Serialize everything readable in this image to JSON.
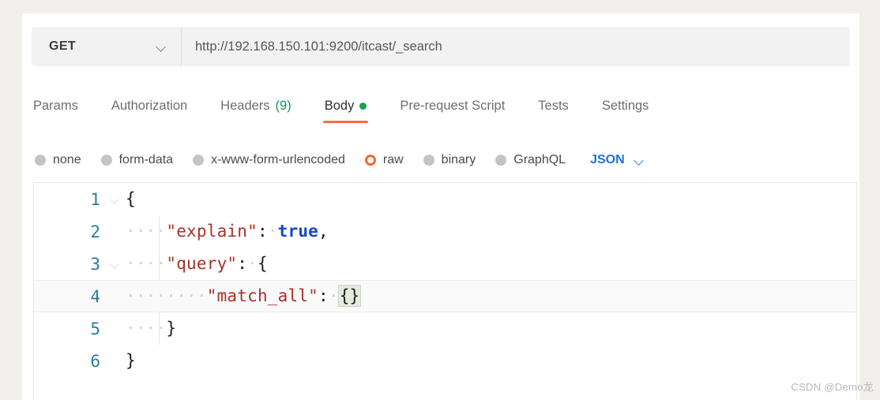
{
  "request_bar": {
    "method": "GET",
    "method_dropdown_icon": "chevron-down-icon",
    "url": "http://192.168.150.101:9200/itcast/_search",
    "url_placeholder": "Enter request URL"
  },
  "tabs": [
    {
      "label": "Params",
      "active": false,
      "count": null,
      "dot": false
    },
    {
      "label": "Authorization",
      "active": false,
      "count": null,
      "dot": false
    },
    {
      "label": "Headers",
      "active": false,
      "count": "(9)",
      "dot": false
    },
    {
      "label": "Body",
      "active": true,
      "count": null,
      "dot": true
    },
    {
      "label": "Pre-request Script",
      "active": false,
      "count": null,
      "dot": false
    },
    {
      "label": "Tests",
      "active": false,
      "count": null,
      "dot": false
    },
    {
      "label": "Settings",
      "active": false,
      "count": null,
      "dot": false
    }
  ],
  "body_types": [
    {
      "label": "none",
      "selected": false
    },
    {
      "label": "form-data",
      "selected": false
    },
    {
      "label": "x-www-form-urlencoded",
      "selected": false
    },
    {
      "label": "raw",
      "selected": true
    },
    {
      "label": "binary",
      "selected": false
    },
    {
      "label": "GraphQL",
      "selected": false
    }
  ],
  "body_format": {
    "label": "JSON",
    "dropdown_icon": "chevron-down-icon"
  },
  "editor": {
    "language": "json",
    "active_line": 4,
    "lines": [
      {
        "number": "1",
        "fold": true,
        "active": false,
        "tokens": [
          {
            "t": "{",
            "c": "p"
          }
        ]
      },
      {
        "number": "2",
        "fold": false,
        "active": false,
        "tokens": [
          {
            "t": "····",
            "c": "ws"
          },
          {
            "t": "\"explain\"",
            "c": "k"
          },
          {
            "t": ":",
            "c": "p"
          },
          {
            "t": "·",
            "c": "ws"
          },
          {
            "t": "true",
            "c": "b"
          },
          {
            "t": ",",
            "c": "p"
          }
        ]
      },
      {
        "number": "3",
        "fold": true,
        "active": false,
        "tokens": [
          {
            "t": "····",
            "c": "ws"
          },
          {
            "t": "\"query\"",
            "c": "k"
          },
          {
            "t": ":",
            "c": "p"
          },
          {
            "t": "·",
            "c": "ws"
          },
          {
            "t": "{",
            "c": "p"
          }
        ]
      },
      {
        "number": "4",
        "fold": false,
        "active": true,
        "tokens": [
          {
            "t": "····",
            "c": "ws"
          },
          {
            "t": "····",
            "c": "ws"
          },
          {
            "t": "\"match_all\"",
            "c": "k"
          },
          {
            "t": ":",
            "c": "p"
          },
          {
            "t": "·",
            "c": "ws"
          },
          {
            "t": "{}",
            "c": "p brace-hl"
          }
        ]
      },
      {
        "number": "5",
        "fold": false,
        "active": false,
        "tokens": [
          {
            "t": "····",
            "c": "ws"
          },
          {
            "t": "}",
            "c": "p"
          }
        ]
      },
      {
        "number": "6",
        "fold": false,
        "active": false,
        "tokens": [
          {
            "t": "}",
            "c": "p"
          }
        ]
      }
    ],
    "raw_text": "{\n    \"explain\": true,\n    \"query\": {\n        \"match_all\": {}\n    }\n}"
  },
  "watermark": "CSDN @Demo龙",
  "colors": {
    "accent_orange": "#ff6c37",
    "radio_selected": "#f2673a",
    "tab_count_green": "#0f9b52",
    "body_dot_green": "#16a34a",
    "json_blue": "#1f6fe0",
    "line_number": "#2a7d9e",
    "json_key": "#a8312a",
    "json_boolean": "#1448c6",
    "page_background": "#f2f0ec",
    "panel_background": "#ffffff",
    "url_field_background": "#f2f2f2",
    "bracket_match": "#e4eade"
  }
}
